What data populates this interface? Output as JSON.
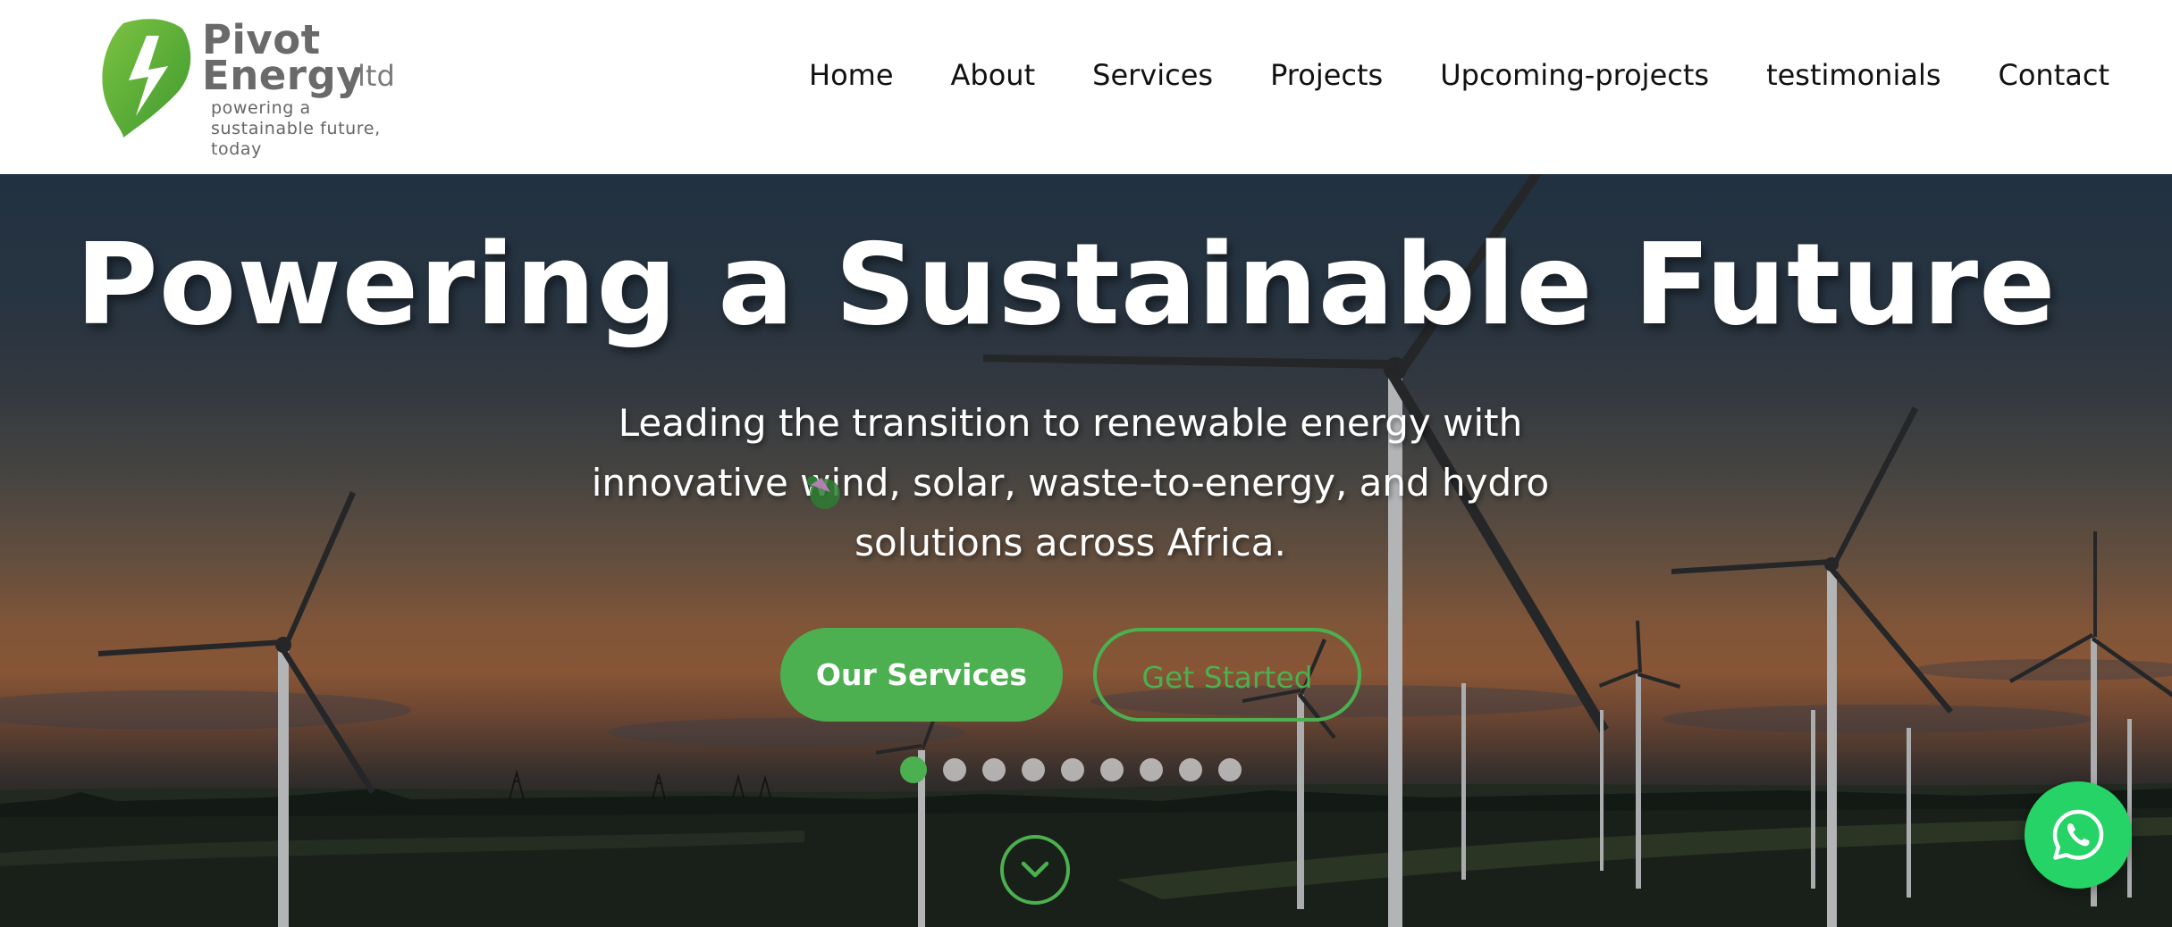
{
  "brand": {
    "line1": "Pivot",
    "line2": "Energy",
    "suffix": "ltd",
    "tagline": "powering a sustainable future, today",
    "accent_color": "#4caf50",
    "logo_icon": "lightning-leaf-icon"
  },
  "nav": {
    "items": [
      {
        "label": "Home"
      },
      {
        "label": "About"
      },
      {
        "label": "Services"
      },
      {
        "label": "Projects"
      },
      {
        "label": "Upcoming-projects"
      },
      {
        "label": "testimonials"
      },
      {
        "label": "Contact"
      }
    ]
  },
  "hero": {
    "title": "Powering a Sustainable Future",
    "subtitle": "Leading the transition to renewable energy with innovative wind, solar, waste-to-energy, and hydro solutions across Africa.",
    "primary_button": "Our Services",
    "secondary_button": "Get Started",
    "slides_total": 9,
    "active_slide": 1,
    "scroll_icon": "chevron-down-icon"
  },
  "floating": {
    "whatsapp_icon": "whatsapp-icon",
    "whatsapp_color": "#25d366"
  }
}
